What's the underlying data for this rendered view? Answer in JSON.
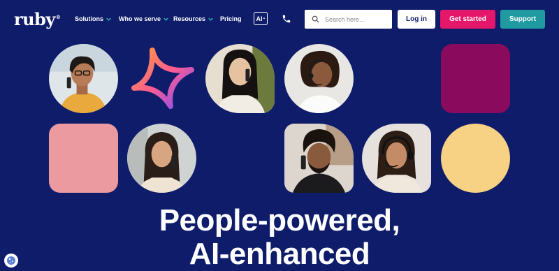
{
  "brand": {
    "logo_text": "ruby",
    "logo_mark": "®"
  },
  "nav": {
    "items": [
      {
        "label": "Solutions",
        "has_dropdown": true
      },
      {
        "label": "Who we serve",
        "has_dropdown": true
      },
      {
        "label": "Resources",
        "has_dropdown": true
      },
      {
        "label": "Pricing",
        "has_dropdown": false
      }
    ],
    "ai_label": "AI",
    "ai_mark": "+",
    "search_placeholder": "Search here...",
    "login_label": "Log in",
    "get_started_label": "Get started",
    "support_label": "Support"
  },
  "hero": {
    "headline_line1": "People-powered,",
    "headline_line2": "AI-enhanced"
  },
  "colors": {
    "background": "#0e1c6a",
    "accent_pink": "#e5176a",
    "accent_teal": "#1f9aa0",
    "tile_plum": "#8a0a5e",
    "tile_rose": "#eb9aa0",
    "tile_butter": "#f7d184"
  },
  "icons": [
    "chevron-down-icon",
    "phone-icon",
    "search-icon",
    "sparkle-star-icon",
    "cookie-icon"
  ]
}
